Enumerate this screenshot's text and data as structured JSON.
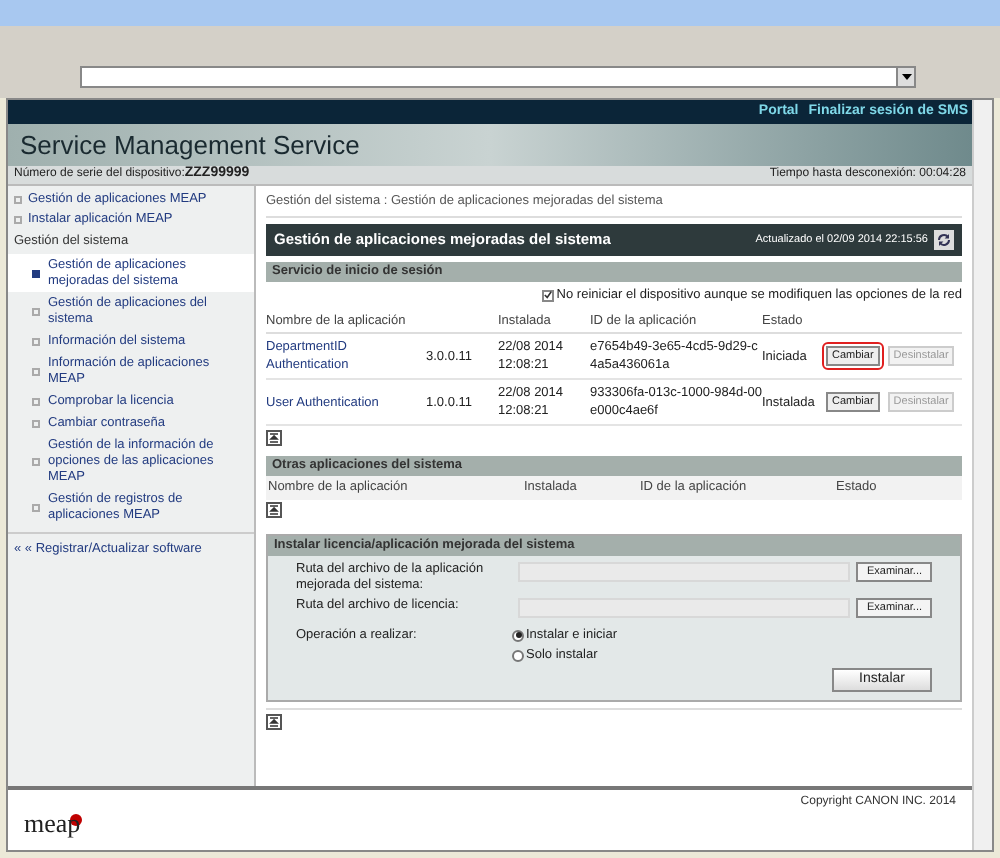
{
  "header": {
    "links": [
      "Portal",
      "Finalizar sesión de SMS"
    ],
    "title": "Service Management Service"
  },
  "serial": {
    "label": "Número de serie del dispositivo:",
    "value": "ZZZ99999",
    "timeout": "Tiempo hasta desconexión: 00:04:28"
  },
  "sidebar": {
    "top_items": [
      {
        "label": "Gestión de aplicaciones MEAP",
        "selected": false
      },
      {
        "label": "Instalar aplicación MEAP",
        "selected": false
      }
    ],
    "section": "Gestión del sistema",
    "items": [
      {
        "label": "Gestión de aplicaciones mejoradas del sistema",
        "selected": true
      },
      {
        "label": "Gestión de aplicaciones del sistema",
        "selected": false
      },
      {
        "label": "Información del sistema",
        "selected": false
      },
      {
        "label": "Información de aplicaciones MEAP",
        "selected": false
      },
      {
        "label": "Comprobar la licencia",
        "selected": false
      },
      {
        "label": "Cambiar contraseña",
        "selected": false
      },
      {
        "label": "Gestión de la información de opciones de las aplicaciones MEAP",
        "selected": false
      },
      {
        "label": "Gestión de registros de aplicaciones MEAP",
        "selected": false
      }
    ],
    "footer_link": "« « Registrar/Actualizar software"
  },
  "breadcrumb": "Gestión del sistema : Gestión de aplicaciones mejoradas del sistema",
  "panel": {
    "title": "Gestión de aplicaciones mejoradas del sistema",
    "updated": "Actualizado el 02/09 2014 22:15:56"
  },
  "login_service": {
    "title": "Servicio de inicio de sesión",
    "option": {
      "label": "No reiniciar el dispositivo aunque se modifiquen las opciones de la red",
      "checked": true
    },
    "columns": [
      "Nombre de la aplicación",
      "Instalada",
      "ID de la aplicación",
      "Estado"
    ],
    "rows": [
      {
        "name": "DepartmentID Authentication",
        "version": "3.0.0.11",
        "installed": "22/08 2014 12:08:21",
        "id": "e7654b49-3e65-4cd5-9d29-c4a5a436061a",
        "status": "Iniciada",
        "change": "Cambiar",
        "highlighted": true,
        "uninstall": "Desinstalar",
        "uninstall_disabled": true
      },
      {
        "name": "User Authentication",
        "version": "1.0.0.11",
        "installed": "22/08 2014 12:08:21",
        "id": "933306fa-013c-1000-984d-00e000c4ae6f",
        "status": "Instalada",
        "change": "Cambiar",
        "highlighted": false,
        "uninstall": "Desinstalar",
        "uninstall_disabled": true
      }
    ]
  },
  "other_apps": {
    "title": "Otras aplicaciones del sistema",
    "columns": [
      "Nombre de la aplicación",
      "Instalada",
      "ID de la aplicación",
      "Estado"
    ]
  },
  "install": {
    "title": "Instalar licencia/aplicación mejorada del sistema",
    "fields": [
      {
        "label": "Ruta del archivo de la aplicación mejorada del sistema:",
        "button": "Examinar..."
      },
      {
        "label": "Ruta del archivo de licencia:",
        "button": "Examinar..."
      }
    ],
    "operation_label": "Operación a realizar:",
    "options": [
      {
        "label": "Instalar e iniciar",
        "selected": true
      },
      {
        "label": "Solo instalar",
        "selected": false
      }
    ],
    "submit": "Instalar"
  },
  "footer": {
    "logo": "mea",
    "logo_end": "p",
    "copyright": "Copyright CANON INC. 2014"
  }
}
